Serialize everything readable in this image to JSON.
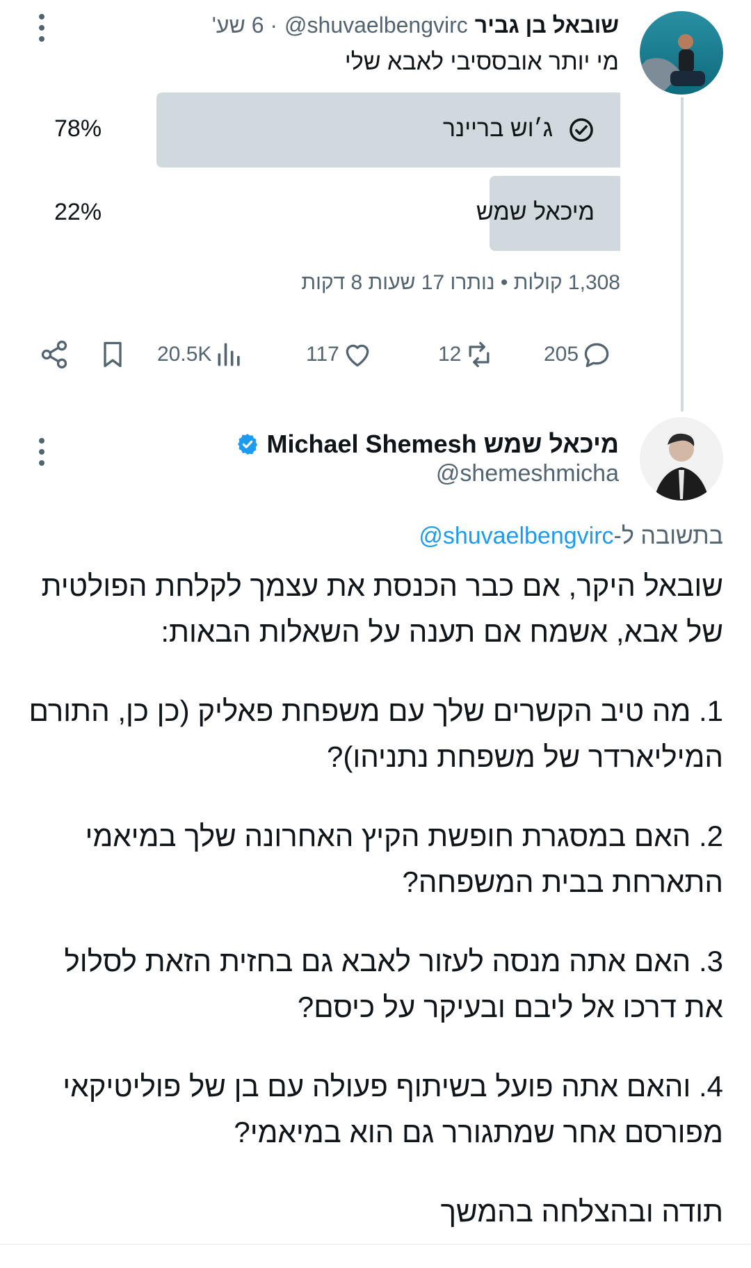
{
  "tweet1": {
    "display_name": "שובאל בן גביר",
    "handle": "@shuvaelbengvirc",
    "time": "· 6 שע'",
    "text": "מי יותר אובססיבי לאבא שלי",
    "poll": {
      "options": [
        {
          "label": "ג׳וש בריינר",
          "percent": "78%",
          "value": 78,
          "selected": true
        },
        {
          "label": "מיכאל שמש",
          "percent": "22%",
          "value": 22,
          "selected": false
        }
      ],
      "meta": "1,308 קולות • נותרו 17 שעות 8 דקות"
    },
    "actions": {
      "replies": "205",
      "retweets": "12",
      "likes": "117",
      "views": "20.5K"
    }
  },
  "tweet2": {
    "display_name": "מיכאל שמש Michael Shemesh",
    "handle": "@shemeshmicha",
    "verified_color": "#1d9bf0",
    "reply_prefix": "בתשובה ל-",
    "reply_handle": "@shuvaelbengvirc",
    "paragraphs": [
      "שובאל היקר, אם כבר הכנסת את עצמך לקלחת הפולטית של אבא, אשמח אם תענה על השאלות הבאות:",
      "1. מה טיב הקשרים שלך עם משפחת פאליק (כן כן, התורם המיליארדר של משפחת נתניהו)?",
      "2. האם במסגרת חופשת הקיץ האחרונה שלך במיאמי התארחת בבית המשפחה?",
      "3. האם אתה מנסה לעזור לאבא גם בחזית הזאת לסלול את דרכו אל ליבם ובעיקר על כיסם?",
      "4. והאם אתה פועל בשיתוף פעולה עם בן של פוליטיקאי מפורסם אחר שמתגורר גם הוא במיאמי?",
      "תודה ובהצלחה בהמשך"
    ]
  },
  "colors": {
    "text": "#0f1419",
    "secondary": "#536471",
    "link": "#1d9bf0",
    "poll_bar": "#cfd9de"
  },
  "icons": [
    "check-circle-icon",
    "share-icon",
    "bookmark-icon",
    "views-icon",
    "like-icon",
    "retweet-icon",
    "reply-icon",
    "verified-badge-icon",
    "more-icon"
  ]
}
